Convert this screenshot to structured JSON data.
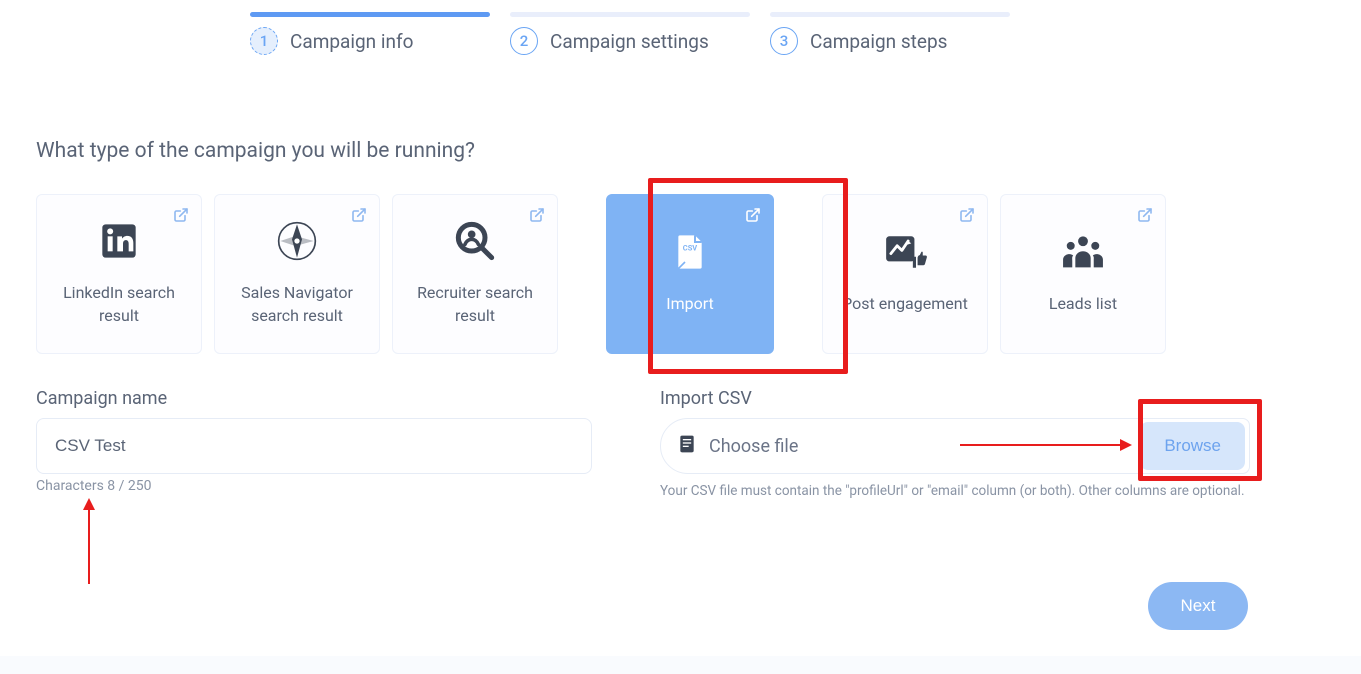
{
  "stepper": {
    "steps": [
      {
        "num": "1",
        "label": "Campaign info"
      },
      {
        "num": "2",
        "label": "Campaign settings"
      },
      {
        "num": "3",
        "label": "Campaign steps"
      }
    ]
  },
  "heading": "What type of the campaign you will be running?",
  "cards": [
    {
      "key": "linkedin-search",
      "title": "LinkedIn search\nresult"
    },
    {
      "key": "sales-navigator",
      "title": "Sales Navigator\nsearch result"
    },
    {
      "key": "recruiter",
      "title": "Recruiter search\nresult"
    },
    {
      "key": "import",
      "title": "Import"
    },
    {
      "key": "post-engagement",
      "title": "Post engagement"
    },
    {
      "key": "leads-list",
      "title": "Leads list"
    }
  ],
  "campaign_name": {
    "label": "Campaign name",
    "value": "CSV Test",
    "counter": "Characters 8 / 250"
  },
  "import_csv": {
    "label": "Import CSV",
    "placeholder": "Choose file",
    "browse": "Browse",
    "hint": "Your CSV file must contain the \"profileUrl\" or \"email\" column (or both). Other columns are optional."
  },
  "next": "Next"
}
